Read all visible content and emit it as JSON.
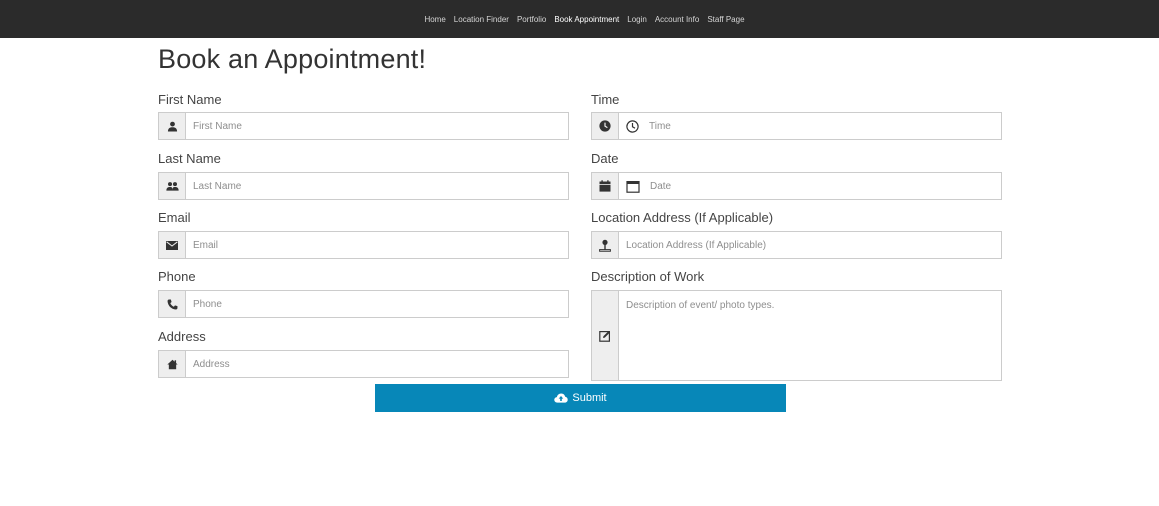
{
  "nav": {
    "items": [
      {
        "label": "Home"
      },
      {
        "label": "Location Finder"
      },
      {
        "label": "Portfolio"
      },
      {
        "label": "Book Appointment"
      },
      {
        "label": "Login"
      },
      {
        "label": "Account Info"
      },
      {
        "label": "Staff Page"
      }
    ],
    "active": "Book Appointment"
  },
  "page": {
    "title": "Book an Appointment!"
  },
  "form": {
    "left": [
      {
        "label": "First Name",
        "placeholder": "First Name",
        "icon": "user-icon"
      },
      {
        "label": "Last Name",
        "placeholder": "Last Name",
        "icon": "users-icon"
      },
      {
        "label": "Email",
        "placeholder": "Email",
        "icon": "envelope-icon"
      },
      {
        "label": "Phone",
        "placeholder": "Phone",
        "icon": "phone-icon"
      },
      {
        "label": "Address",
        "placeholder": "Address",
        "icon": "home-icon"
      }
    ],
    "right": [
      {
        "label": "Time",
        "placeholder": "Time",
        "icon": "clock-icon"
      },
      {
        "label": "Date",
        "placeholder": "Date",
        "icon": "calendar-icon"
      },
      {
        "label": "Location Address (If Applicable)",
        "placeholder": "Location Address (If Applicable)",
        "icon": "map-pin-icon"
      },
      {
        "label": "Description of Work",
        "placeholder": "Description of event/ photo types.",
        "icon": "edit-icon"
      }
    ],
    "submit_label": "Submit"
  },
  "colors": {
    "navbar": "#2b2b2b",
    "submit": "#0787b8",
    "addon": "#eeeeee",
    "border": "#cccccc"
  }
}
